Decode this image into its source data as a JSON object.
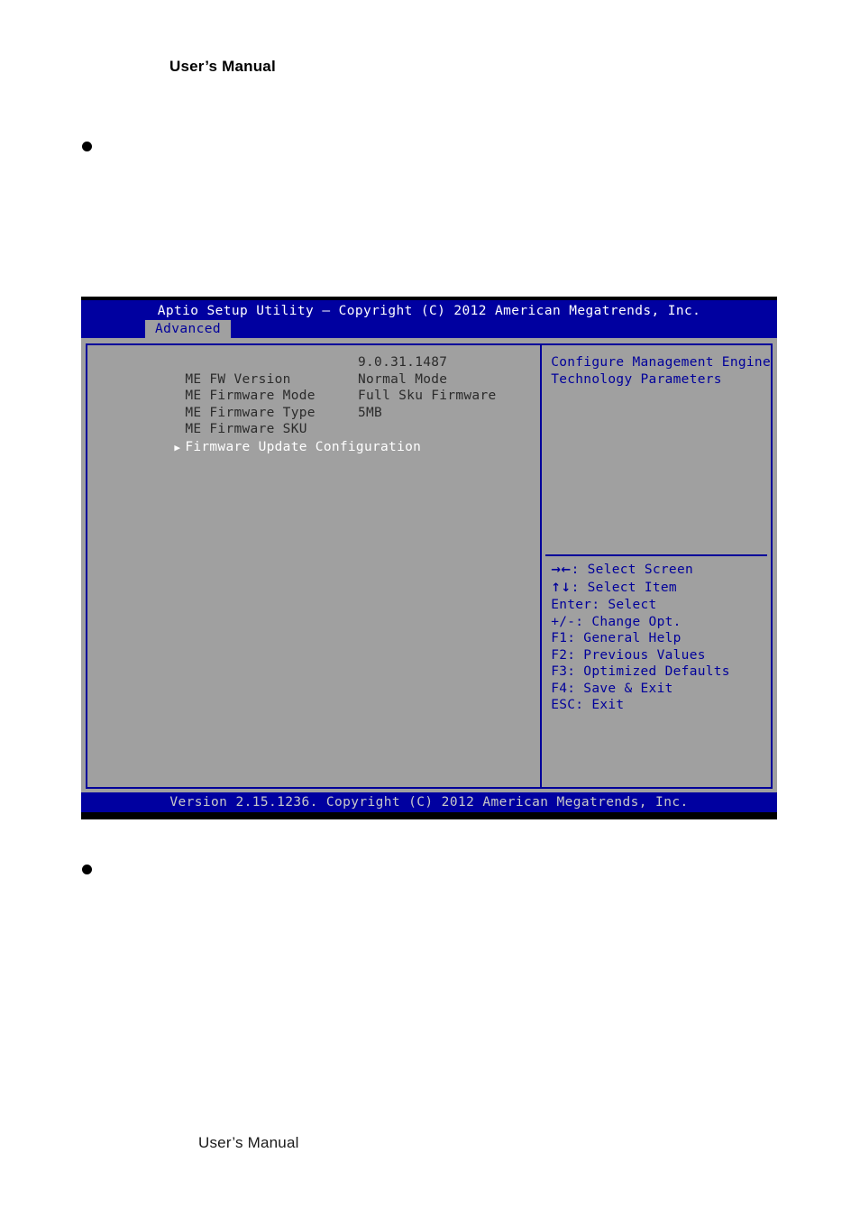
{
  "page": {
    "header_text": "User’s Manual",
    "footer_text": "User’s Manual",
    "bullets": [
      "",
      ""
    ]
  },
  "bios": {
    "title": "Aptio Setup Utility – Copyright (C) 2012 American Megatrends, Inc.",
    "active_tab": "Advanced",
    "footer": "Version 2.15.1236. Copyright (C) 2012 American Megatrends, Inc.",
    "settings": [
      {
        "label": "ME FW Version",
        "value": "9.0.31.1487"
      },
      {
        "label": "ME Firmware Mode",
        "value": "Normal Mode"
      },
      {
        "label": "ME Firmware Type",
        "value": "Full Sku Firmware"
      },
      {
        "label": "ME Firmware SKU",
        "value": "5MB"
      }
    ],
    "submenu": {
      "arrow": "▶",
      "label": "Firmware Update Configuration"
    },
    "help": {
      "line1": "Configure Management Engine",
      "line2": "Technology Parameters"
    },
    "keys": [
      {
        "glyph": "→←",
        "text": ": Select Screen"
      },
      {
        "glyph": "↑↓",
        "text": ": Select Item"
      },
      {
        "glyph": "",
        "text": "Enter: Select"
      },
      {
        "glyph": "",
        "text": "+/-: Change Opt."
      },
      {
        "glyph": "",
        "text": "F1: General Help"
      },
      {
        "glyph": "",
        "text": "F2: Previous Values"
      },
      {
        "glyph": "",
        "text": "F3: Optimized Defaults"
      },
      {
        "glyph": "",
        "text": "F4: Save & Exit"
      },
      {
        "glyph": "",
        "text": "ESC: Exit"
      }
    ],
    "colors": {
      "chrome_blue": "#0000a0",
      "text_blue": "#00009a",
      "panel_gray": "#a0a0a0",
      "footer_text": "#c8c8c8"
    }
  }
}
